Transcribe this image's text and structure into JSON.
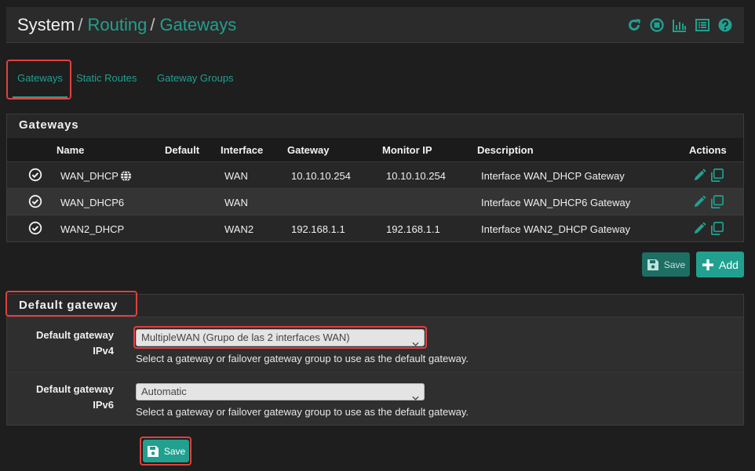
{
  "breadcrumb": [
    "System",
    "Routing",
    "Gateways"
  ],
  "header_icons": [
    "reload-icon",
    "stop-icon",
    "bar-chart-icon",
    "list-icon",
    "help-icon"
  ],
  "tabs": [
    {
      "label": "Gateways",
      "active": true
    },
    {
      "label": "Static Routes",
      "active": false
    },
    {
      "label": "Gateway Groups",
      "active": false
    }
  ],
  "gateways_panel": {
    "title": "Gateways",
    "columns": [
      "Name",
      "Default",
      "Interface",
      "Gateway",
      "Monitor IP",
      "Description",
      "Actions"
    ],
    "rows": [
      {
        "status_icon": "check-circle-icon",
        "name": "WAN_DHCP",
        "name_icon": "globe-icon",
        "default": "",
        "interface": "WAN",
        "gateway": "10.10.10.254",
        "monitor_ip": "10.10.10.254",
        "description": "Interface WAN_DHCP Gateway"
      },
      {
        "status_icon": "check-circle-icon",
        "name": "WAN_DHCP6",
        "default": "",
        "interface": "WAN",
        "gateway": "",
        "monitor_ip": "",
        "description": "Interface WAN_DHCP6 Gateway"
      },
      {
        "status_icon": "check-circle-icon",
        "name": "WAN2_DHCP",
        "default": "",
        "interface": "WAN2",
        "gateway": "192.168.1.1",
        "monitor_ip": "192.168.1.1",
        "description": "Interface WAN2_DHCP Gateway"
      }
    ],
    "row_actions": [
      "edit-icon",
      "copy-icon"
    ],
    "save_label": "Save",
    "add_label": "Add"
  },
  "default_gateway_panel": {
    "title": "Default gateway",
    "ipv4": {
      "label_line1": "Default gateway",
      "label_line2": "IPv4",
      "value": "MultipleWAN (Grupo de las 2 interfaces WAN)",
      "help": "Select a gateway or failover gateway group to use as the default gateway."
    },
    "ipv6": {
      "label_line1": "Default gateway",
      "label_line2": "IPv6",
      "value": "Automatic",
      "help": "Select a gateway or failover gateway group to use as the default gateway."
    },
    "save_label": "Save"
  },
  "colors": {
    "accent": "#21a08f",
    "highlight_outline": "#e0403f",
    "background": "#1e1e1e"
  }
}
